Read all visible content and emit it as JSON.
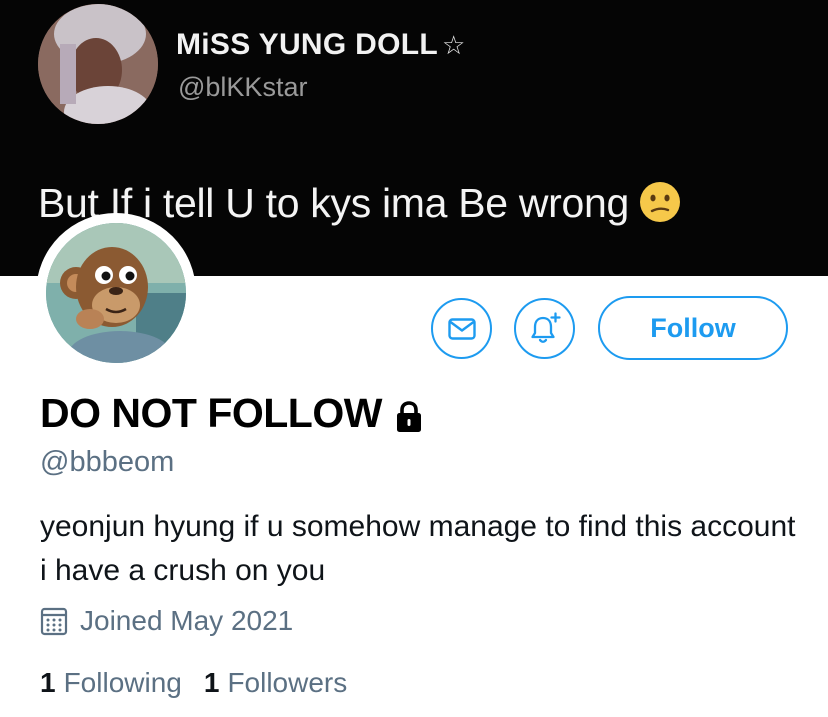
{
  "banner": {
    "tweet_author_name": "MiSS YUNG DOLL",
    "tweet_author_star": "☆",
    "tweet_author_handle": "@blKKstar",
    "tweet_text": "But If i tell U to kys ima Be wrong"
  },
  "actions": {
    "follow_label": "Follow",
    "message_icon": "mail-icon",
    "notify_icon": "bell-plus-icon"
  },
  "profile": {
    "display_name": "DO NOT FOLLOW",
    "username": "@bbbeom",
    "bio": "yeonjun hyung if u somehow manage to find this account i have a crush on you",
    "joined": "Joined May 2021",
    "following_count": "1",
    "following_label": "Following",
    "followers_count": "1",
    "followers_label": "Followers"
  },
  "colors": {
    "accent": "#1d9bf0",
    "secondary_text": "#5b7083",
    "banner_bg": "#050505"
  }
}
